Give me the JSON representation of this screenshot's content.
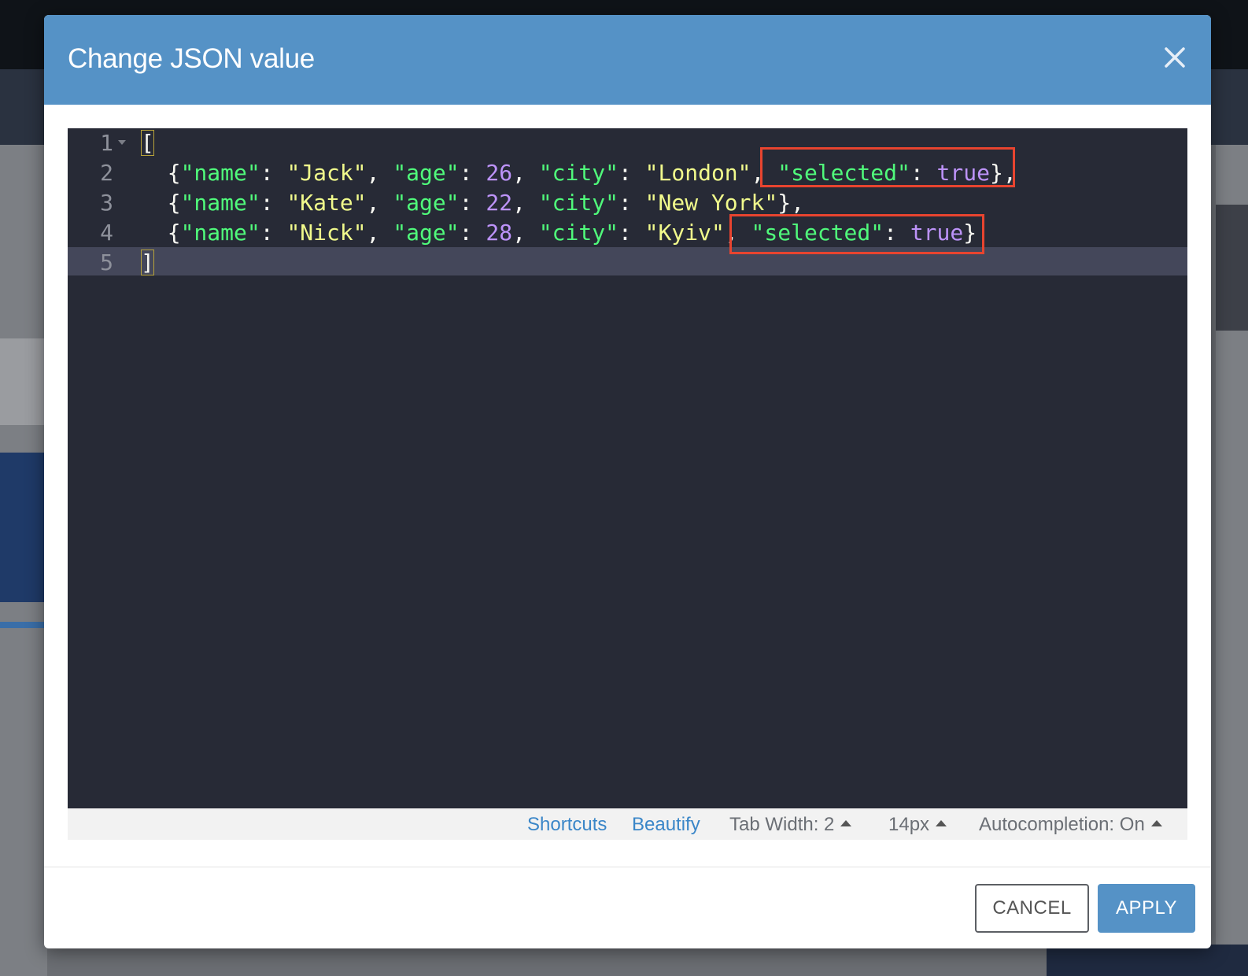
{
  "dialog": {
    "title": "Change JSON value",
    "close_icon": "close-icon"
  },
  "editor": {
    "lines": [
      {
        "number": "1",
        "tokens": [
          {
            "t": "p",
            "v": "["
          }
        ]
      },
      {
        "number": "2",
        "tokens": [
          {
            "t": "p",
            "v": "  {"
          },
          {
            "t": "k",
            "v": "\"name\""
          },
          {
            "t": "p",
            "v": ": "
          },
          {
            "t": "s",
            "v": "\"Jack\""
          },
          {
            "t": "p",
            "v": ", "
          },
          {
            "t": "k",
            "v": "\"age\""
          },
          {
            "t": "p",
            "v": ": "
          },
          {
            "t": "n",
            "v": "26"
          },
          {
            "t": "p",
            "v": ", "
          },
          {
            "t": "k",
            "v": "\"city\""
          },
          {
            "t": "p",
            "v": ": "
          },
          {
            "t": "s",
            "v": "\"London\""
          },
          {
            "t": "p",
            "v": ", "
          },
          {
            "t": "k",
            "v": "\"selected\""
          },
          {
            "t": "p",
            "v": ": "
          },
          {
            "t": "n",
            "v": "true"
          },
          {
            "t": "p",
            "v": "},"
          }
        ]
      },
      {
        "number": "3",
        "tokens": [
          {
            "t": "p",
            "v": "  {"
          },
          {
            "t": "k",
            "v": "\"name\""
          },
          {
            "t": "p",
            "v": ": "
          },
          {
            "t": "s",
            "v": "\"Kate\""
          },
          {
            "t": "p",
            "v": ", "
          },
          {
            "t": "k",
            "v": "\"age\""
          },
          {
            "t": "p",
            "v": ": "
          },
          {
            "t": "n",
            "v": "22"
          },
          {
            "t": "p",
            "v": ", "
          },
          {
            "t": "k",
            "v": "\"city\""
          },
          {
            "t": "p",
            "v": ": "
          },
          {
            "t": "s",
            "v": "\"New York\""
          },
          {
            "t": "p",
            "v": "},"
          }
        ]
      },
      {
        "number": "4",
        "tokens": [
          {
            "t": "p",
            "v": "  {"
          },
          {
            "t": "k",
            "v": "\"name\""
          },
          {
            "t": "p",
            "v": ": "
          },
          {
            "t": "s",
            "v": "\"Nick\""
          },
          {
            "t": "p",
            "v": ", "
          },
          {
            "t": "k",
            "v": "\"age\""
          },
          {
            "t": "p",
            "v": ": "
          },
          {
            "t": "n",
            "v": "28"
          },
          {
            "t": "p",
            "v": ", "
          },
          {
            "t": "k",
            "v": "\"city\""
          },
          {
            "t": "p",
            "v": ": "
          },
          {
            "t": "s",
            "v": "\"Kyiv\""
          },
          {
            "t": "p",
            "v": ", "
          },
          {
            "t": "k",
            "v": "\"selected\""
          },
          {
            "t": "p",
            "v": ": "
          },
          {
            "t": "n",
            "v": "true"
          },
          {
            "t": "p",
            "v": "}"
          }
        ]
      },
      {
        "number": "5",
        "tokens": [
          {
            "t": "p",
            "v": "]"
          }
        ]
      }
    ]
  },
  "statusbar": {
    "shortcuts": "Shortcuts",
    "beautify": "Beautify",
    "tab_width": "Tab Width: 2",
    "font_size": "14px",
    "autocompletion": "Autocompletion: On"
  },
  "footer": {
    "cancel_label": "CANCEL",
    "apply_label": "APPLY"
  },
  "colors": {
    "header": "#5592c6",
    "editor_bg": "#272a36",
    "key": "#50fa7b",
    "string": "#f1fa8c",
    "number": "#bd93f9",
    "highlight_box": "#e8442f"
  }
}
